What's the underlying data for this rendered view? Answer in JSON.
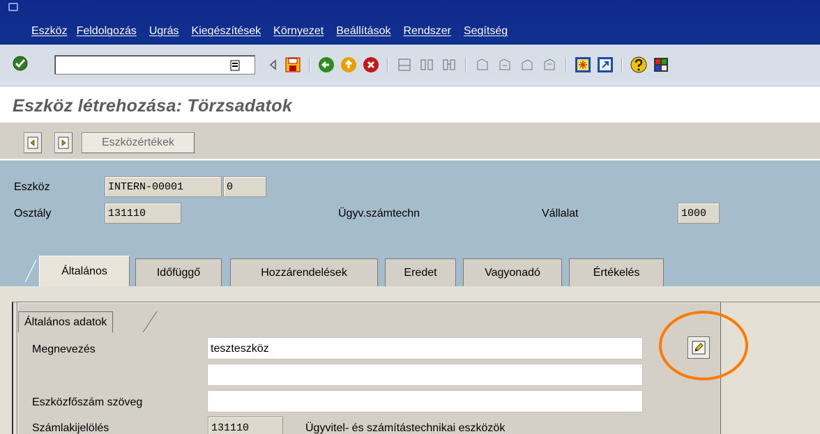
{
  "menu": {
    "items": [
      "Eszköz",
      "Feldolgozás",
      "Ugrás",
      "Kiegészítések",
      "Környezet",
      "Beállítások",
      "Rendszer",
      "Segítség"
    ]
  },
  "toolbar": {
    "command_value": "",
    "icons": [
      "check-icon",
      "history-icon",
      "back-arrow-icon",
      "save-icon",
      "back-icon",
      "exit-icon",
      "cancel-icon",
      "print-icon",
      "find-icon",
      "find-next-icon",
      "first-page-icon",
      "prev-page-icon",
      "next-page-icon",
      "last-page-icon",
      "new-session-icon",
      "shortcut-icon",
      "help-icon",
      "layout-icon"
    ]
  },
  "title": "Eszköz létrehozása: Törzsadatok",
  "app_toolbar": {
    "values_button": "Eszközértékek"
  },
  "header": {
    "asset_label": "Eszköz",
    "asset_value": "INTERN-00001",
    "sub_number": "0",
    "class_label": "Osztály",
    "class_value": "131110",
    "class_desc": "Ügyv.számtechn",
    "company_label": "Vállalat",
    "company_value": "1000"
  },
  "tabs": [
    {
      "label": "Általános",
      "active": true
    },
    {
      "label": "Időfüggő",
      "active": false
    },
    {
      "label": "Hozzárendelések",
      "active": false
    },
    {
      "label": "Eredet",
      "active": false
    },
    {
      "label": "Vagyonadó",
      "active": false
    },
    {
      "label": "Értékelés",
      "active": false
    }
  ],
  "general": {
    "group_title": "Általános adatok",
    "desc_label": "Megnevezés",
    "desc_value": "teszteszköz",
    "desc2_value": "",
    "main_text_label": "Eszközfőszám szöveg",
    "main_text_value": "",
    "acct_label": "Számlakijelölés",
    "acct_value": "131110",
    "acct_desc": "Ügyvitel- és számítástechnikai eszközök"
  },
  "colors": {
    "menubar": "#10308e",
    "header_bg": "#a4bccb",
    "highlight": "#ff7a00"
  }
}
